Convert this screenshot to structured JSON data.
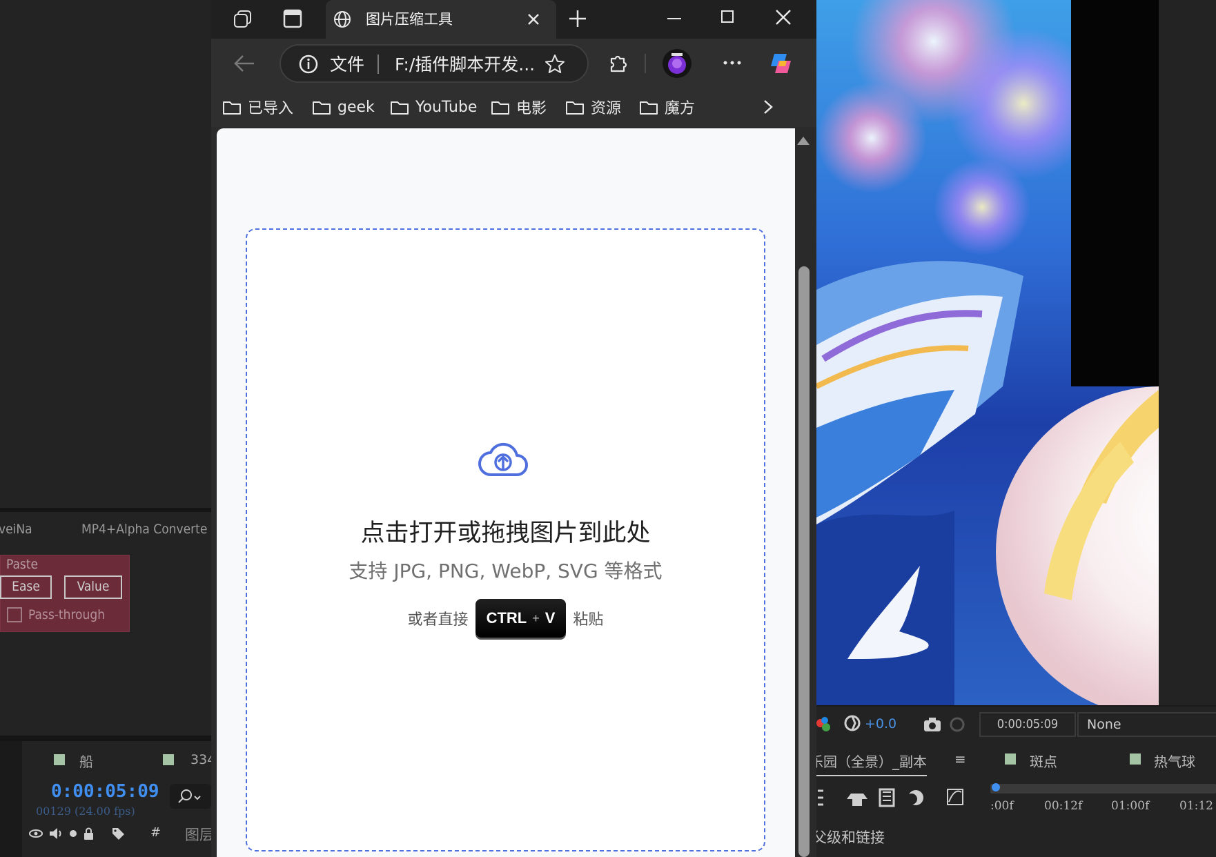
{
  "browser": {
    "tab_title": "图片压缩工具",
    "omnibox": {
      "scheme_label": "文件",
      "url": "F:/插件脚本开发..."
    },
    "favorites": [
      "已导入",
      "geek",
      "YouTube",
      "电影",
      "资源",
      "魔方"
    ]
  },
  "page": {
    "drop_title": "点击打开或拖拽图片到此处",
    "drop_subtitle": "支持 JPG, PNG, WebP, SVG 等格式",
    "paste_prefix": "或者直接",
    "kbd_ctrl": "CTRL",
    "kbd_plus": "+",
    "kbd_v": "V",
    "paste_suffix": "粘贴"
  },
  "ae": {
    "tab_left": "veiNa",
    "tab_right": "MP4+Alpha Converte",
    "paste_label": "Paste",
    "ease_button": "Ease",
    "value_button": "Value",
    "passthrough_label": "Pass-through",
    "timeline_tab1": "船",
    "timeline_tab2": "334",
    "timecode": "0:00:05:09",
    "frames": "00129 (24.00 fps)",
    "hash_col": "#",
    "layer_col": "图层",
    "exposure": "+0.0",
    "viewer_timecode": "0:00:05:09",
    "view_select": "None",
    "comp_tab_a": "乐园（全景）_副本",
    "comp_tab_b": "斑点",
    "comp_tab_c": "热气球",
    "parent_link": "父级和链接",
    "ruler_ticks": [
      ":00f",
      "00:12f",
      "01:00f",
      "01:12"
    ]
  },
  "colors": {
    "accent": "#4f6fdf",
    "ae_blue": "#3f8ef0",
    "ae_red_panel": "#6b2b38"
  }
}
